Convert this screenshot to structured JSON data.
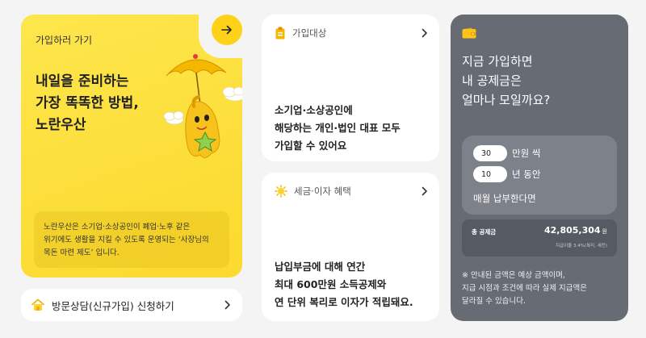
{
  "hero": {
    "link_label": "가입하러 가기",
    "title_lines": [
      "내일을 준비하는",
      "가장 똑똑한 방법,",
      "노란우산"
    ],
    "desc_lines": [
      "노란우산은 소기업·소상공인이 폐업·노후 같은",
      "위기에도 생활을 지킬 수 있도록 운영되는 ‘사장님의",
      "목돈 마련 제도’ 입니다."
    ]
  },
  "consult": {
    "label": "방문상담(신규가입) 신청하기"
  },
  "target": {
    "heading": "가입대상",
    "body_lines": [
      "소기업·소상공인에",
      "해당하는 개인·법인 대표 모두",
      "가입할 수 있어요"
    ]
  },
  "benefit": {
    "heading": "세금·이자 혜택",
    "body_lines": [
      "납입부금에 대해 연간",
      "최대 600만원 소득공제와",
      "연 단위 복리로 이자가 적립돼요."
    ]
  },
  "calc": {
    "title_lines": [
      "지금 가입하면",
      "내 공제금은",
      "얼마나 모일까요?"
    ],
    "amount_value": "30",
    "amount_unit": "만원 씩",
    "years_value": "10",
    "years_unit": "년 동안",
    "pay_label": "매월 납부한다면",
    "total_label": "총 공제금",
    "total_value": "42,805,304",
    "total_unit": "원",
    "total_sub": "지급이율 3.4%(복리, 세전)",
    "note_lines": [
      "※ 안내된 금액은 예상 금액이며,",
      "지급 시점과 조건에 따라 실제 지급액은",
      "달라질 수 있습니다."
    ]
  },
  "colors": {
    "accent_yellow": "#fde047",
    "calc_bg": "#666b74"
  }
}
